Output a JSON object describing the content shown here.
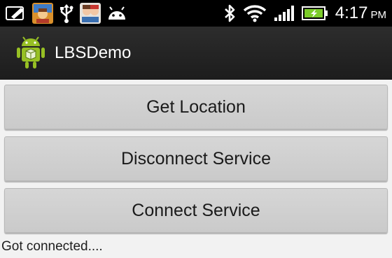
{
  "status_bar": {
    "time": "4:17",
    "ampm": "PM",
    "icons_left": [
      "edit-note-icon",
      "game-app-icon",
      "usb-icon",
      "manga-app-icon",
      "android-icon"
    ],
    "icons_right": [
      "bluetooth-icon",
      "wifi-icon",
      "signal-icon",
      "battery-icon"
    ],
    "battery_color": "#7ccc2a"
  },
  "action_bar": {
    "title": "LBSDemo",
    "icon": "android-app-icon",
    "icon_color": "#97c024"
  },
  "buttons": {
    "get_location": "Get Location",
    "disconnect_service": "Disconnect Service",
    "connect_service": "Connect Service"
  },
  "status_message": "Got connected...."
}
